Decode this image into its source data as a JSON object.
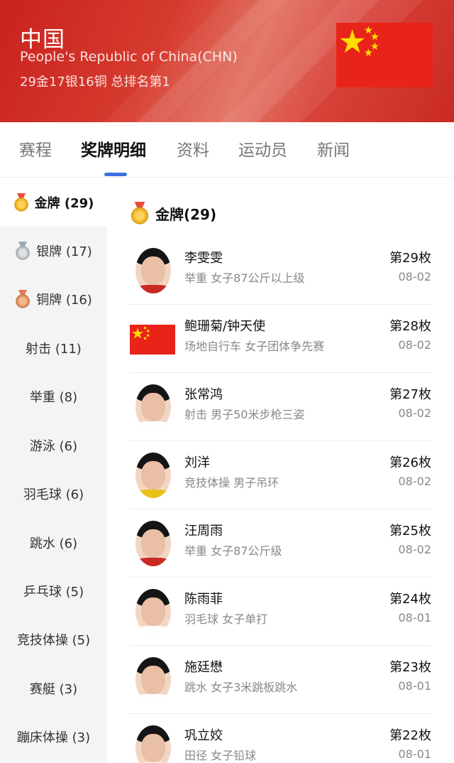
{
  "header": {
    "country": "中国",
    "full_name": "People's Republic of China(CHN)",
    "summary": "29金17银16铜 总排名第1",
    "colors": {
      "red": "#e8231a",
      "star": "#ffde00"
    }
  },
  "tabs": [
    {
      "label": "赛程"
    },
    {
      "label": "奖牌明细"
    },
    {
      "label": "资料"
    },
    {
      "label": "运动员"
    },
    {
      "label": "新闻"
    }
  ],
  "sidebar": {
    "items": [
      {
        "label": "金牌 (29)",
        "icon": "gold-medal-icon"
      },
      {
        "label": "银牌 (17)",
        "icon": "silver-medal-icon"
      },
      {
        "label": "铜牌 (16)",
        "icon": "bronze-medal-icon"
      },
      {
        "label": "射击 (11)"
      },
      {
        "label": "举重 (8)"
      },
      {
        "label": "游泳 (6)"
      },
      {
        "label": "羽毛球 (6)"
      },
      {
        "label": "跳水 (6)"
      },
      {
        "label": "乒乓球 (5)"
      },
      {
        "label": "竞技体操 (5)"
      },
      {
        "label": "赛艇 (3)"
      },
      {
        "label": "蹦床体操 (3)"
      }
    ]
  },
  "main": {
    "section_title": "金牌(29)",
    "entries": [
      {
        "name": "李雯雯",
        "event": "举重 女子87公斤以上级",
        "rank": "第29枚",
        "date": "08-02",
        "avatar": "athlete-photo"
      },
      {
        "name": "鲍珊菊/钟天使",
        "event": "场地自行车 女子团体争先赛",
        "rank": "第28枚",
        "date": "08-02",
        "avatar": "china-flag"
      },
      {
        "name": "张常鸿",
        "event": "射击 男子50米步枪三姿",
        "rank": "第27枚",
        "date": "08-02",
        "avatar": "athlete-photo"
      },
      {
        "name": "刘洋",
        "event": "竞技体操 男子吊环",
        "rank": "第26枚",
        "date": "08-02",
        "avatar": "athlete-photo"
      },
      {
        "name": "汪周雨",
        "event": "举重 女子87公斤级",
        "rank": "第25枚",
        "date": "08-02",
        "avatar": "athlete-photo"
      },
      {
        "name": "陈雨菲",
        "event": "羽毛球 女子单打",
        "rank": "第24枚",
        "date": "08-01",
        "avatar": "athlete-photo"
      },
      {
        "name": "施廷懋",
        "event": "跳水 女子3米跳板跳水",
        "rank": "第23枚",
        "date": "08-01",
        "avatar": "athlete-photo"
      },
      {
        "name": "巩立姣",
        "event": "田径 女子铅球",
        "rank": "第22枚",
        "date": "08-01",
        "avatar": "athlete-photo"
      }
    ]
  }
}
